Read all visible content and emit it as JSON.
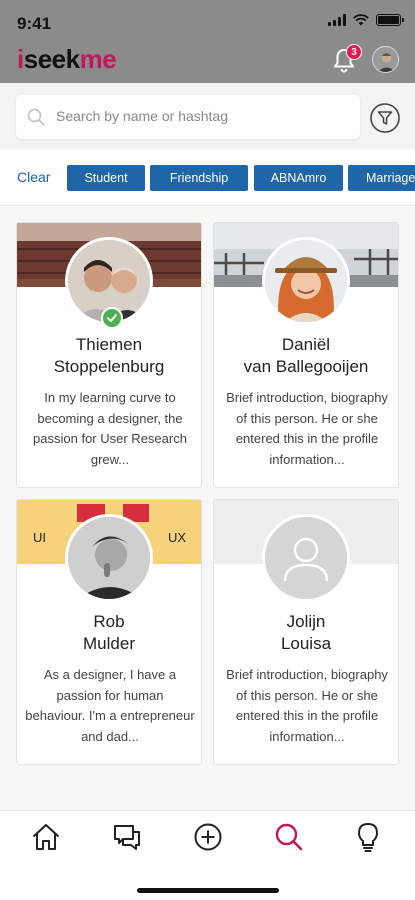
{
  "status_bar": {
    "time": "9:41"
  },
  "app": {
    "logo": {
      "part1": "i",
      "part2": "seek",
      "part3": "me"
    },
    "notification_count": "3",
    "accent_color": "#c2185b",
    "tag_color": "#1f66a8"
  },
  "search": {
    "placeholder": "Search by name or hashtag"
  },
  "filters": {
    "clear_label": "Clear",
    "tags": [
      "Student",
      "Friendship",
      "ABNAmro",
      "Marriage"
    ]
  },
  "profiles": [
    {
      "first_line": "Thiemen",
      "second_line": "Stoppelenburg",
      "bio": "In my learning curve to becoming a designer, the passion for User Research grew...",
      "verified": true
    },
    {
      "first_line": "Daniël",
      "second_line": "van Ballegooijen",
      "bio": "Brief introduction, biography of this person. He or she entered this in the profile information...",
      "verified": false
    },
    {
      "first_line": "Rob",
      "second_line": "Mulder",
      "bio": "As a designer, I have a passion for human behaviour. I'm a entrepreneur and dad...",
      "verified": false,
      "banner_labels": {
        "left": "UI",
        "right": "UX"
      }
    },
    {
      "first_line": "Jolijn",
      "second_line": "Louisa",
      "bio": "Brief introduction, biography of this person. He or she entered this in the profile information...",
      "verified": false
    }
  ],
  "bottom_nav": [
    {
      "icon": "home-icon"
    },
    {
      "icon": "chat-icon"
    },
    {
      "icon": "add-icon"
    },
    {
      "icon": "search-icon",
      "active": true
    },
    {
      "icon": "lightbulb-icon"
    }
  ]
}
